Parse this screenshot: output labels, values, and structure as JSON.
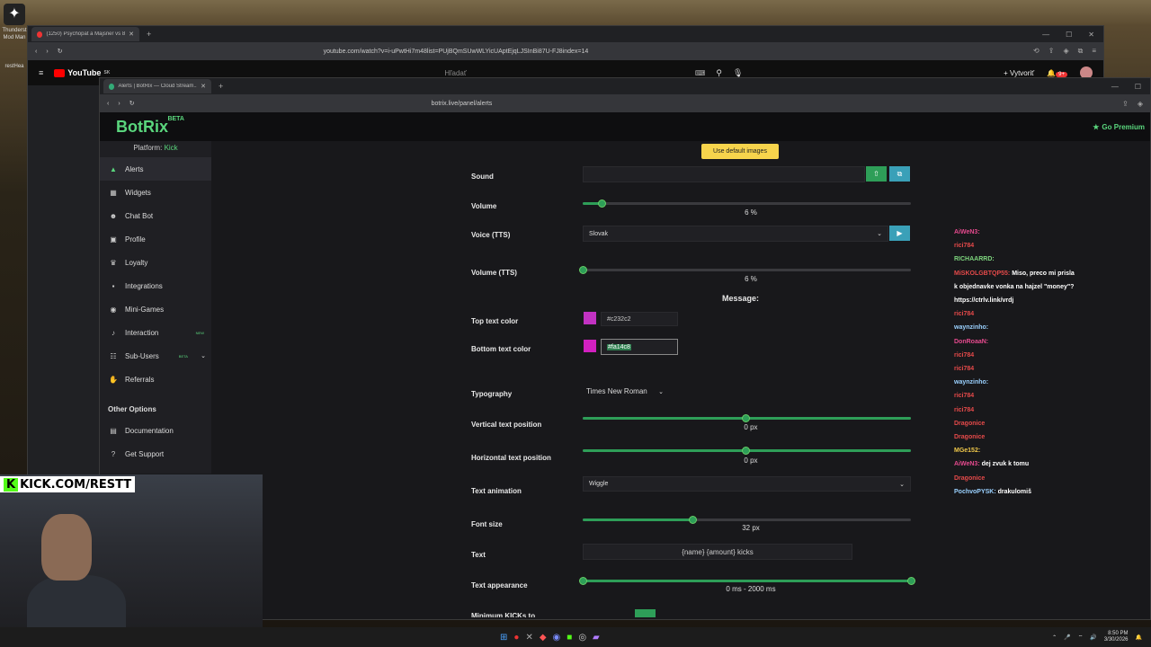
{
  "desktop": {
    "icon_label_1": "Thunderst",
    "icon_label_2": "Mod Man",
    "icon_label_3": "restHea"
  },
  "back_browser": {
    "tab_title": "(1250) Psychopat a Majsner vs 8...",
    "url": "youtube.com/watch?v=i-uPwtHi7m48list=PUjBQmSUwWLYicUAptEjqLJSInBi87U-FJ8index=14",
    "youtube": {
      "logo": "YouTube",
      "region": "SK",
      "search_placeholder": "Hľadať",
      "create_label": "Vytvoriť",
      "notif_count": "9+"
    }
  },
  "front_browser": {
    "tab_title": "Alerts | BotRix — Cloud Stream...",
    "url": "botrix.live/panel/alerts"
  },
  "botrix": {
    "brand": "BotRix",
    "brand_tag": "BETA",
    "premium": "Go Premium",
    "platform_label": "Platform:",
    "platform_value": "Kick",
    "nav": [
      {
        "label": "Alerts",
        "icon": "warning-icon"
      },
      {
        "label": "Widgets",
        "icon": "grid-icon"
      },
      {
        "label": "Chat Bot",
        "icon": "robot-icon"
      },
      {
        "label": "Profile",
        "icon": "profile-icon"
      },
      {
        "label": "Loyalty",
        "icon": "trophy-icon"
      },
      {
        "label": "Integrations",
        "icon": "plug-icon"
      },
      {
        "label": "Mini-Games",
        "icon": "gamepad-icon"
      },
      {
        "label": "Interaction",
        "icon": "music-icon",
        "badge": "NEW"
      },
      {
        "label": "Sub-Users",
        "icon": "users-icon",
        "badge": "BETA"
      },
      {
        "label": "Referrals",
        "icon": "handshake-icon"
      }
    ],
    "other_options_heading": "Other Options",
    "other": [
      {
        "label": "Documentation",
        "icon": "book-icon"
      },
      {
        "label": "Get Support",
        "icon": "help-icon"
      }
    ]
  },
  "form": {
    "default_images_button": "Use default images",
    "sound_label": "Sound",
    "volume_label": "Volume",
    "volume_value": "6",
    "volume_unit": "%",
    "volume_fraction": 0.06,
    "voice_label": "Voice (TTS)",
    "voice_value": "Slovak",
    "volume_tts_label": "Volume (TTS)",
    "volume_tts_value": "6",
    "volume_tts_unit": "%",
    "message_heading": "Message:",
    "top_color_label": "Top text color",
    "top_color_value": "#c232c2",
    "bottom_color_label": "Bottom text color",
    "bottom_color_value": "#fa14c8",
    "typography_label": "Typography",
    "typography_value": "Times New Roman",
    "vertical_label": "Vertical text position",
    "vertical_value": "0",
    "vertical_unit": "px",
    "horizontal_label": "Horizontal text position",
    "horizontal_value": "0",
    "horizontal_unit": "px",
    "animation_label": "Text animation",
    "animation_value": "Wiggle",
    "font_size_label": "Font size",
    "font_size_value": "32",
    "font_size_unit": "px",
    "text_label": "Text",
    "text_value": "{name} {amount} kicks",
    "appearance_label": "Text appearance",
    "appearance_min": "0",
    "appearance_min_unit": "ms",
    "appearance_sep": "-",
    "appearance_max": "2000",
    "appearance_max_unit": "ms",
    "cut_label": "Minimum KICKs to"
  },
  "chat": [
    {
      "user": "AiWeN3:",
      "color": "#e64a8e",
      "msg": ""
    },
    {
      "user": "rici784",
      "color": "#e64a4a",
      "msg": ""
    },
    {
      "user": "RICHAARRD:",
      "color": "#7ed67e",
      "msg": ""
    },
    {
      "user": "MiSKOLGBTQP55:",
      "color": "#e64a4a",
      "msg": "Miso, preco mi prisla"
    },
    {
      "user": "",
      "color": "#fff",
      "msg": "k objednavke vonka na hajzel \"money\"?"
    },
    {
      "user": "",
      "color": "#fff",
      "msg": "https://ctrlv.link/vrdj"
    },
    {
      "user": "rici784",
      "color": "#e64a4a",
      "msg": ""
    },
    {
      "user": "waynzinho:",
      "color": "#9ad1ff",
      "msg": ""
    },
    {
      "user": "DonRoaaN:",
      "color": "#e64a8e",
      "msg": ""
    },
    {
      "user": "rici784",
      "color": "#e64a4a",
      "msg": ""
    },
    {
      "user": "rici784",
      "color": "#e64a4a",
      "msg": ""
    },
    {
      "user": "waynzinho:",
      "color": "#9ad1ff",
      "msg": ""
    },
    {
      "user": "rici784",
      "color": "#e64a4a",
      "msg": ""
    },
    {
      "user": "rici784",
      "color": "#e64a4a",
      "msg": ""
    },
    {
      "user": "Dragonice",
      "color": "#e64a4a",
      "msg": ""
    },
    {
      "user": "Dragonice",
      "color": "#e64a4a",
      "msg": ""
    },
    {
      "user": "MGe152:",
      "color": "#f0c84a",
      "msg": ""
    },
    {
      "user": "AiWeN3:",
      "color": "#e64a8e",
      "msg": "dej zvuk k tomu"
    },
    {
      "user": "Dragonice",
      "color": "#e64a4a",
      "msg": ""
    },
    {
      "user": "PochvoPYSK:",
      "color": "#9ad1ff",
      "msg": "drakulomiš"
    }
  ],
  "overlay": {
    "kick_k": "K",
    "kick_tag": "KICK.COM/RESTT"
  },
  "taskbar": {
    "time": "8:50 PM",
    "date": "3/30/2026"
  }
}
